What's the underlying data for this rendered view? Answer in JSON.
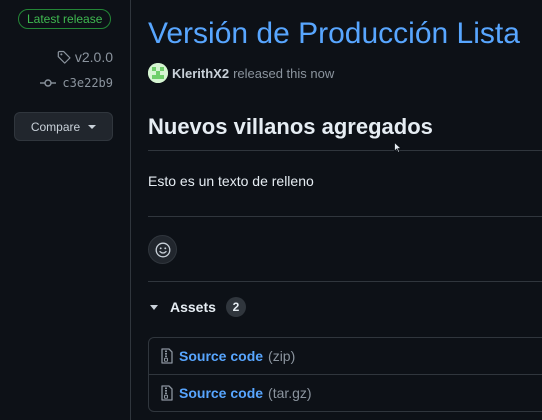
{
  "sidebar": {
    "latest_badge": "Latest release",
    "tag": "v2.0.0",
    "commit": "c3e22b9",
    "compare_label": "Compare"
  },
  "release": {
    "title": "Versión de Producción Lista",
    "author": "KlerithX2",
    "released_text": "released this now",
    "notes_heading": "Nuevos villanos agregados",
    "notes_body": "Esto es un texto de relleno"
  },
  "assets": {
    "label": "Assets",
    "count": "2",
    "items": [
      {
        "name": "Source code",
        "ext": "(zip)",
        "icon": "file-zip-icon"
      },
      {
        "name": "Source code",
        "ext": "(tar.gz)",
        "icon": "file-zip-icon"
      }
    ]
  },
  "colors": {
    "background": "#0d1117",
    "link": "#58a6ff",
    "latest_green": "#3fb950",
    "muted": "#8b949e",
    "border": "#30363d"
  },
  "icons": {
    "tag": "tag-icon",
    "commit": "git-commit-icon",
    "dropdown": "triangle-down-icon",
    "reaction": "smiley-icon",
    "assets_toggle": "triangle-down-icon"
  }
}
